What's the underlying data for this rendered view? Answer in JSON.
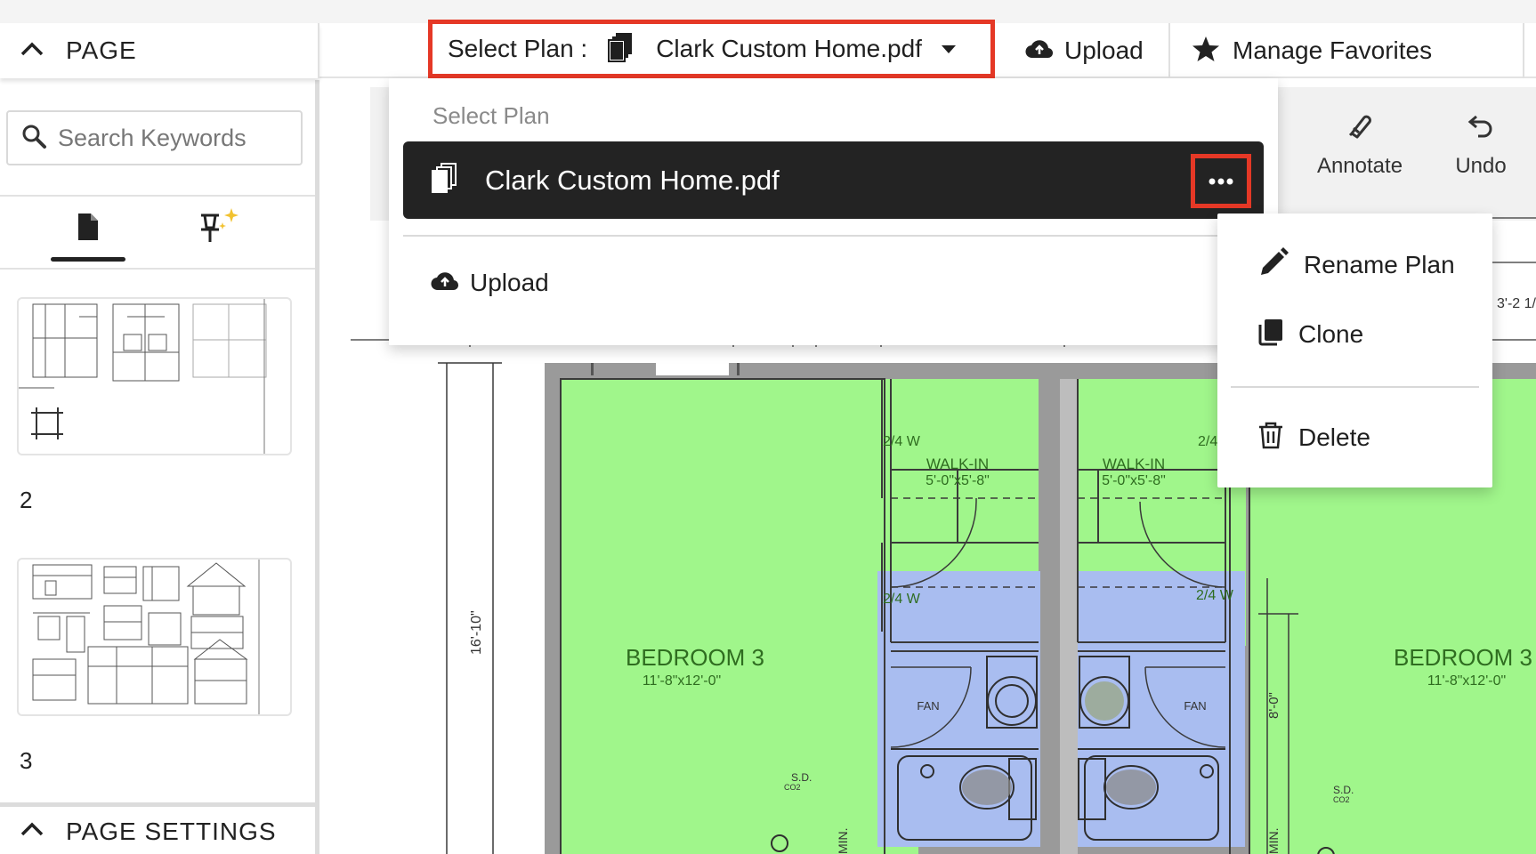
{
  "toolbar": {
    "page_label": "PAGE",
    "select_plan_label": "Select Plan :",
    "selected_plan": "Clark Custom Home.pdf",
    "upload_label": "Upload",
    "manage_favorites_label": "Manage Favorites"
  },
  "sidebar": {
    "search_placeholder": "Search Keywords",
    "tabs": [
      {
        "icon": "document-icon",
        "active": true
      },
      {
        "icon": "pin-sparkle-icon",
        "active": false
      }
    ],
    "pages": [
      {
        "number": "2"
      },
      {
        "number": "3"
      }
    ],
    "page_settings_label": "PAGE SETTINGS"
  },
  "tools": {
    "annotate_label": "Annotate",
    "undo_label": "Undo"
  },
  "dropdown": {
    "title": "Select Plan",
    "plans": [
      {
        "name": "Clark Custom Home.pdf"
      }
    ],
    "upload_label": "Upload"
  },
  "context_menu": {
    "items": [
      {
        "label": "Rename Plan",
        "icon": "pencil-icon"
      },
      {
        "label": "Clone",
        "icon": "clone-icon"
      },
      {
        "label": "Delete",
        "icon": "trash-icon"
      }
    ]
  },
  "drawing": {
    "labels": {
      "bedroom_left": "BEDROOM 3",
      "bedroom_left_dim": "11'-8\"x12'-0\"",
      "bedroom_right": "BEDROOM 3",
      "bedroom_right_dim": "11'-8\"x12'-0\"",
      "walkin_left": "WALK-IN",
      "walkin_left_dim": "5'-0\"x5'-8\"",
      "walkin_right": "WALK-IN",
      "walkin_right_dim": "5'-0\"x5'-8\"",
      "door_a": "2/4 W",
      "door_b": "2/4",
      "door_c": "2/4 W",
      "door_d": "2/4 W",
      "fan_left": "FAN",
      "fan_right": "FAN",
      "dim_vertical": "16'-10\"",
      "dim_right": "8'-0\"",
      "dim_top_right": "3'-2 1/",
      "sd_left": "S.D.",
      "co2_left": "CO2",
      "sd_right": "S.D.",
      "co2_right": "CO2",
      "min_left": "MIN.",
      "min_right": "MIN."
    },
    "colors": {
      "room_green": "#a0f68b",
      "bath_blue": "#a9bdf0",
      "wall_gray": "#8f8f8f"
    }
  }
}
